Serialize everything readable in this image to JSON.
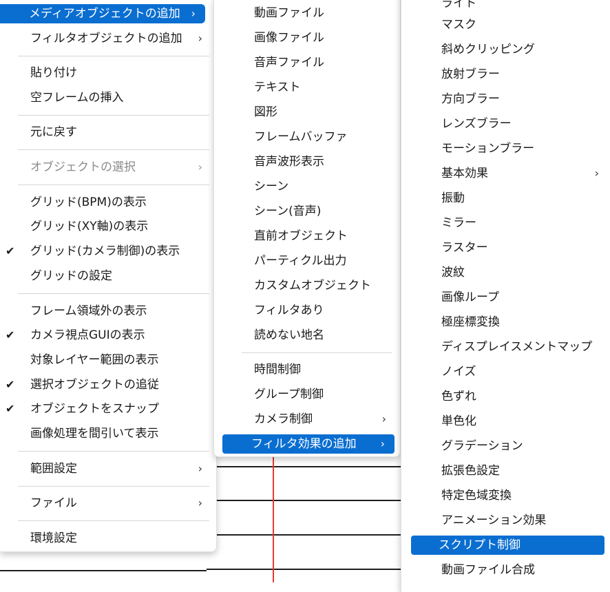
{
  "menu_main": {
    "items": [
      {
        "label": "メディアオブジェクトの追加",
        "submenu": "›",
        "highlighted": true
      },
      {
        "label": "フィルタオブジェクトの追加",
        "submenu": "›"
      },
      {
        "label": "貼り付け"
      },
      {
        "label": "空フレームの挿入"
      },
      {
        "label": "元に戻す"
      },
      {
        "label": "オブジェクトの選択",
        "submenu": "›",
        "disabled": true
      },
      {
        "label": "グリッド(BPM)の表示"
      },
      {
        "label": "グリッド(XY軸)の表示"
      },
      {
        "label": "グリッド(カメラ制御)の表示",
        "check": "✔"
      },
      {
        "label": "グリッドの設定"
      },
      {
        "label": "フレーム領域外の表示"
      },
      {
        "label": "カメラ視点GUIの表示",
        "check": "✔"
      },
      {
        "label": "対象レイヤー範囲の表示"
      },
      {
        "label": "選択オブジェクトの追従",
        "check": "✔"
      },
      {
        "label": "オブジェクトをスナップ",
        "check": "✔"
      },
      {
        "label": "画像処理を間引いて表示"
      },
      {
        "label": "範囲設定",
        "submenu": "›"
      },
      {
        "label": "ファイル",
        "submenu": "›"
      },
      {
        "label": "環境設定"
      }
    ]
  },
  "menu_media": {
    "items": [
      {
        "label": "動画ファイル"
      },
      {
        "label": "画像ファイル"
      },
      {
        "label": "音声ファイル"
      },
      {
        "label": "テキスト"
      },
      {
        "label": "図形"
      },
      {
        "label": "フレームバッファ"
      },
      {
        "label": "音声波形表示"
      },
      {
        "label": "シーン"
      },
      {
        "label": "シーン(音声)"
      },
      {
        "label": "直前オブジェクト"
      },
      {
        "label": "パーティクル出力"
      },
      {
        "label": "カスタムオブジェクト"
      },
      {
        "label": "フィルタあり"
      },
      {
        "label": "読めない地名"
      },
      {
        "label": "時間制御"
      },
      {
        "label": "グループ制御"
      },
      {
        "label": "カメラ制御",
        "submenu": "›"
      },
      {
        "label": "フィルタ効果の追加",
        "submenu": "›",
        "highlighted": true
      }
    ]
  },
  "menu_filter": {
    "items": [
      {
        "label": "ライト"
      },
      {
        "label": "マスク"
      },
      {
        "label": "斜めクリッピング"
      },
      {
        "label": "放射ブラー"
      },
      {
        "label": "方向ブラー"
      },
      {
        "label": "レンズブラー"
      },
      {
        "label": "モーションブラー"
      },
      {
        "label": "基本効果",
        "submenu": "›"
      },
      {
        "label": "振動"
      },
      {
        "label": "ミラー"
      },
      {
        "label": "ラスター"
      },
      {
        "label": "波紋"
      },
      {
        "label": "画像ループ"
      },
      {
        "label": "極座標変換"
      },
      {
        "label": "ディスプレイスメントマップ"
      },
      {
        "label": "ノイズ"
      },
      {
        "label": "色ずれ"
      },
      {
        "label": "単色化"
      },
      {
        "label": "グラデーション"
      },
      {
        "label": "拡張色設定"
      },
      {
        "label": "特定色域変換"
      },
      {
        "label": "アニメーション効果"
      },
      {
        "label": "スクリプト制御",
        "highlighted": true
      },
      {
        "label": "動画ファイル合成"
      }
    ]
  },
  "colors": {
    "highlight": "#0a6ed1",
    "disabled": "#8a8a8a",
    "timeline_red": "#e53935"
  }
}
